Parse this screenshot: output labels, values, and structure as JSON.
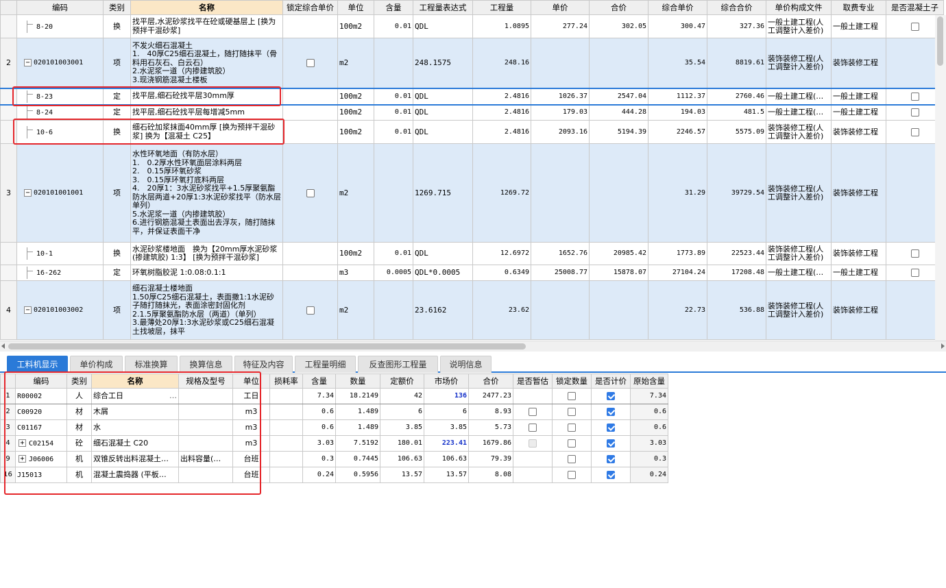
{
  "top_grid": {
    "headers": [
      "编码",
      "类别",
      "名称",
      "锁定综合单价",
      "单位",
      "含量",
      "工程量表达式",
      "工程量",
      "单价",
      "合价",
      "综合单价",
      "综合合价",
      "单价构成文件",
      "取费专业",
      "是否混凝土子"
    ],
    "rows": [
      {
        "kind": "sub",
        "rownum": "",
        "code": "8-20",
        "cat": "换",
        "name": "找平层,水泥砂浆找平在砼或硬基层上 [换为预拌干混砂浆]",
        "lock": "",
        "unit": "100m2",
        "content": "0.01",
        "expr": "QDL",
        "qty": "1.0895",
        "price": "277.24",
        "total": "302.05",
        "cprice": "300.47",
        "ctotal": "327.36",
        "fee_file": "一般土建工程(人工调整计入差价)",
        "fee_major": "一般土建工程",
        "concrete": "unchecked"
      },
      {
        "kind": "item",
        "rownum": "2",
        "code": "020101003001",
        "cat": "项",
        "name": "不发火细石混凝土\n1.　40厚C25细石混凝土，随打随抹平（骨料用石灰石、白云石）\n2.水泥浆一道（内掺建筑胶）\n3.现浇钢筋混凝土楼板",
        "lock": "unchecked",
        "unit": "m2",
        "content": "",
        "expr": "248.1575",
        "qty": "248.16",
        "price": "",
        "total": "",
        "cprice": "35.54",
        "ctotal": "8819.61",
        "fee_file": "装饰装修工程(人工调整计入差价)",
        "fee_major": "装饰装修工程",
        "concrete": ""
      },
      {
        "kind": "sub",
        "selected": true,
        "rownum": "",
        "code": "8-23",
        "cat": "定",
        "name": "找平层,细石砼找平层30mm厚",
        "lock": "",
        "unit": "100m2",
        "content": "0.01",
        "expr": "QDL",
        "qty": "2.4816",
        "price": "1026.37",
        "total": "2547.04",
        "cprice": "1112.37",
        "ctotal": "2760.46",
        "fee_file": "一般土建工程(…",
        "fee_major": "一般土建工程",
        "concrete": "unchecked"
      },
      {
        "kind": "sub",
        "rownum": "",
        "code": "8-24",
        "cat": "定",
        "name": "找平层,细石砼找平层每增减5mm",
        "lock": "",
        "unit": "100m2",
        "content": "0.01",
        "expr": "QDL",
        "qty": "2.4816",
        "price": "179.03",
        "total": "444.28",
        "cprice": "194.03",
        "ctotal": "481.5",
        "fee_file": "一般土建工程(…",
        "fee_major": "一般土建工程",
        "concrete": "unchecked"
      },
      {
        "kind": "sub",
        "rownum": "",
        "code": "10-6",
        "cat": "换",
        "name": "细石砼加浆抹面40mm厚 [换为预拌干混砂浆] 换为【混凝土 C25】",
        "lock": "",
        "unit": "100m2",
        "content": "0.01",
        "expr": "QDL",
        "qty": "2.4816",
        "price": "2093.16",
        "total": "5194.39",
        "cprice": "2246.57",
        "ctotal": "5575.09",
        "fee_file": "装饰装修工程(人工调整计入差价)",
        "fee_major": "装饰装修工程",
        "concrete": "unchecked"
      },
      {
        "kind": "item",
        "rownum": "3",
        "code": "020101001001",
        "cat": "项",
        "name": "水性环氧地面（有防水层）\n1.　0.2厚水性环氧面层涂料两层\n2.　0.15厚环氧砂浆\n3.　0.15厚环氧打底料两层\n4.　20厚1：3水泥砂浆找平+1.5厚聚氨酯防水层两道+20厚1:3水泥砂浆找平（防水层单列）\n5.水泥浆一道（内掺建筑胶）\n6.进行钢筋混凝土表面出去浮灰，随打随抹平，并保证表面干净",
        "lock": "unchecked",
        "unit": "m2",
        "content": "",
        "expr": "1269.715",
        "qty": "1269.72",
        "price": "",
        "total": "",
        "cprice": "31.29",
        "ctotal": "39729.54",
        "fee_file": "装饰装修工程(人工调整计入差价)",
        "fee_major": "装饰装修工程",
        "concrete": ""
      },
      {
        "kind": "sub",
        "rownum": "",
        "code": "10-1",
        "cat": "换",
        "name": "水泥砂浆楼地面　换为【20mm厚水泥砂浆(掺建筑胶) 1:3】 [换为预拌干混砂浆]",
        "lock": "",
        "unit": "100m2",
        "content": "0.01",
        "expr": "QDL",
        "qty": "12.6972",
        "price": "1652.76",
        "total": "20985.42",
        "cprice": "1773.89",
        "ctotal": "22523.44",
        "fee_file": "装饰装修工程(人工调整计入差价)",
        "fee_major": "装饰装修工程",
        "concrete": "unchecked"
      },
      {
        "kind": "sub",
        "rownum": "",
        "code": "16-262",
        "cat": "定",
        "name": "环氧树脂胶泥 1:0.08:0.1:1",
        "lock": "",
        "unit": "m3",
        "content": "0.0005",
        "expr": "QDL*0.0005",
        "qty": "0.6349",
        "price": "25008.77",
        "total": "15878.07",
        "cprice": "27104.24",
        "ctotal": "17208.48",
        "fee_file": "一般土建工程(…",
        "fee_major": "一般土建工程",
        "concrete": "unchecked"
      },
      {
        "kind": "item",
        "rownum": "4",
        "code": "020101003002",
        "cat": "项",
        "name": "细石混凝土楼地面\n1.50厚C25细石混凝土，表面撒1:1水泥砂子随打随抹光，表面涂密封固化剂\n2.1.5厚聚氨酯防水层（两道）（单列）\n3.最薄处20厚1:3水泥砂浆或C25细石混凝土找坡层，抹平",
        "lock": "unchecked",
        "unit": "m2",
        "content": "",
        "expr": "23.6162",
        "qty": "23.62",
        "price": "",
        "total": "",
        "cprice": "22.73",
        "ctotal": "536.88",
        "fee_file": "装饰装修工程(人工调整计入差价)",
        "fee_major": "装饰装修工程",
        "concrete": ""
      }
    ]
  },
  "tabs": [
    "工料机显示",
    "单价构成",
    "标准换算",
    "换算信息",
    "特征及内容",
    "工程量明细",
    "反查图形工程量",
    "说明信息"
  ],
  "active_tab": "工料机显示",
  "bottom_grid": {
    "headers": [
      "编码",
      "类别",
      "名称",
      "规格及型号",
      "单位",
      "损耗率",
      "含量",
      "数量",
      "定额价",
      "市场价",
      "合价",
      "是否暂估",
      "锁定数量",
      "是否计价",
      "原始含量"
    ],
    "rows": [
      {
        "rownum": "1",
        "expander": "",
        "code": "R00002",
        "cat": "人",
        "name": "综合工日",
        "spec": "",
        "unit": "工日",
        "loss": "",
        "content": "7.34",
        "qty": "18.2149",
        "quota": "42",
        "market": "136",
        "market_bold": true,
        "total": "2477.23",
        "temp": "none",
        "lockq": "unchecked",
        "priced": "checked",
        "orig": "7.34",
        "active": true,
        "ellipsis": "…"
      },
      {
        "rownum": "2",
        "expander": "",
        "code": "C00920",
        "cat": "材",
        "name": "木屑",
        "spec": "",
        "unit": "m3",
        "loss": "",
        "content": "0.6",
        "qty": "1.489",
        "quota": "6",
        "market": "6",
        "market_bold": false,
        "total": "8.93",
        "temp": "unchecked",
        "lockq": "unchecked",
        "priced": "checked",
        "orig": "0.6"
      },
      {
        "rownum": "3",
        "expander": "",
        "code": "C01167",
        "cat": "材",
        "name": "水",
        "spec": "",
        "unit": "m3",
        "loss": "",
        "content": "0.6",
        "qty": "1.489",
        "quota": "3.85",
        "market": "3.85",
        "market_bold": false,
        "total": "5.73",
        "temp": "unchecked",
        "lockq": "unchecked",
        "priced": "checked",
        "orig": "0.6"
      },
      {
        "rownum": "4",
        "expander": "+",
        "code": "C02154",
        "cat": "砼",
        "name": "细石混凝土 C20",
        "spec": "",
        "unit": "m3",
        "loss": "",
        "content": "3.03",
        "qty": "7.5192",
        "quota": "180.01",
        "market": "223.41",
        "market_bold": true,
        "total": "1679.86",
        "temp": "disabled",
        "lockq": "unchecked",
        "priced": "checked",
        "orig": "3.03"
      },
      {
        "rownum": "9",
        "expander": "+",
        "code": "J06006",
        "cat": "机",
        "name": "双锥反转出料混凝土…",
        "spec": "出料容量(…",
        "unit": "台班",
        "loss": "",
        "content": "0.3",
        "qty": "0.7445",
        "quota": "106.63",
        "market": "106.63",
        "market_bold": false,
        "total": "79.39",
        "temp": "none",
        "lockq": "unchecked",
        "priced": "checked",
        "orig": "0.3"
      },
      {
        "rownum": "16",
        "expander": "",
        "code": "J15013",
        "cat": "机",
        "name": "混凝土震捣器 (平板…",
        "spec": "",
        "unit": "台班",
        "loss": "",
        "content": "0.24",
        "qty": "0.5956",
        "quota": "13.57",
        "market": "13.57",
        "market_bold": false,
        "total": "8.08",
        "temp": "none",
        "lockq": "unchecked",
        "priced": "checked",
        "orig": "0.24"
      }
    ]
  },
  "colors": {
    "accent": "#2a7ad8",
    "item_row": "#ddeaf8",
    "highlight_box": "#e5252a",
    "market_price": "#1330c9"
  }
}
